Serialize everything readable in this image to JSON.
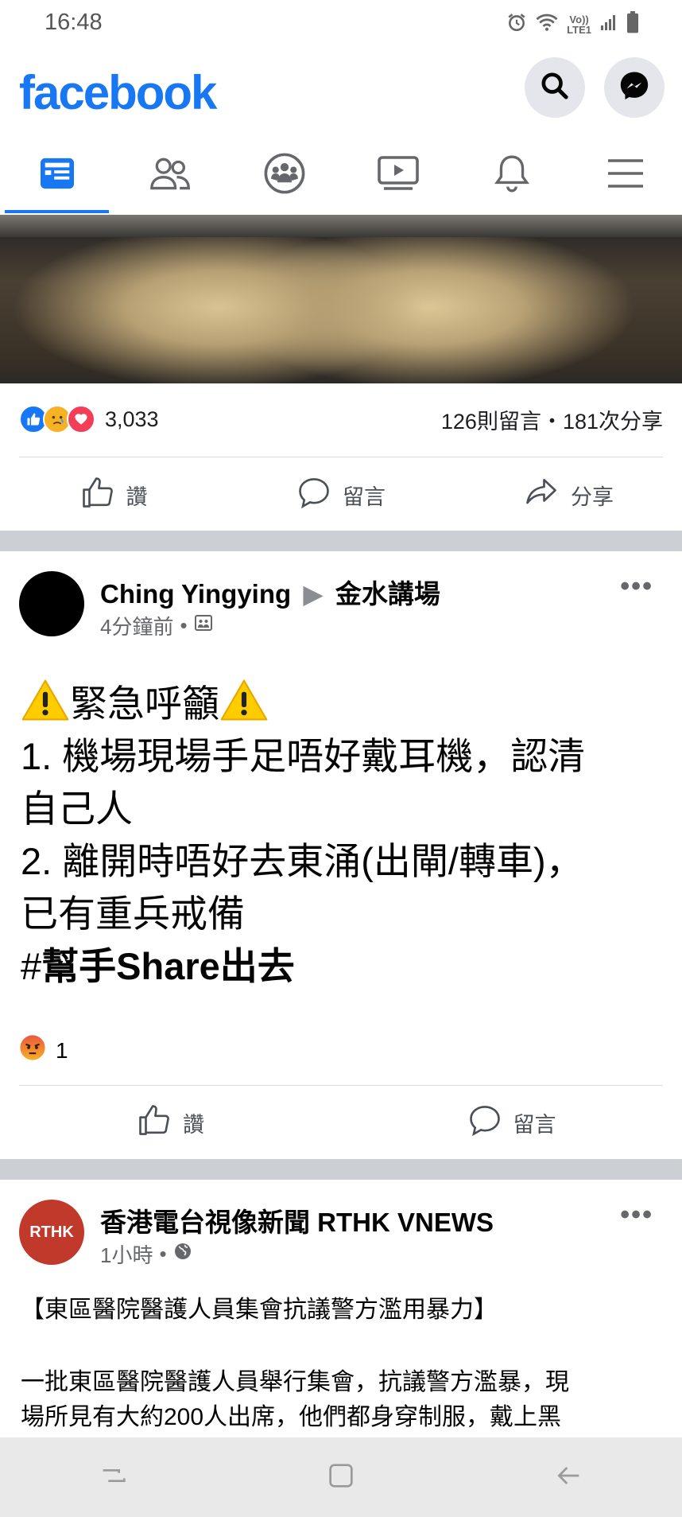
{
  "status_bar": {
    "time": "16:48",
    "network_label_top": "Vo))",
    "network_label_bottom": "LTE1"
  },
  "header": {
    "logo": "facebook"
  },
  "tabs": [
    "news-feed",
    "friends",
    "groups",
    "watch",
    "notifications",
    "menu"
  ],
  "post1": {
    "reaction_count": "3,033",
    "stats": "126則留言・181次分享",
    "actions": {
      "like": "讚",
      "comment": "留言",
      "share": "分享"
    }
  },
  "post2": {
    "author": "Ching Yingying",
    "group": "金水講場",
    "time": "4分鐘前",
    "lines": [
      "緊急呼籲",
      "1. 機場現場手足唔好戴耳機，認清",
      "自己人",
      "2. 離開時唔好去東涌(出閘/轉車)，",
      "已有重兵戒備"
    ],
    "hashtag_prefix": "#",
    "hashtag": "幫手Share出去",
    "reaction_count": "1",
    "actions": {
      "like": "讚",
      "comment": "留言"
    }
  },
  "post3": {
    "author": "香港電台視像新聞 RTHK VNEWS",
    "avatar_text": "RTHK",
    "time": "1小時",
    "headline": "【東區醫院醫護人員集會抗議警方濫用暴力】",
    "body_line1": "一批東區醫院醫護人員舉行集會，抗議警方濫暴，現",
    "body_line2": "場所見有大約200人出席，他們都身穿制服，戴上黑"
  },
  "colors": {
    "brand": "#1877f2",
    "angry": "#f7b125",
    "love": "#f33e58",
    "rthk": "#c0392b"
  }
}
